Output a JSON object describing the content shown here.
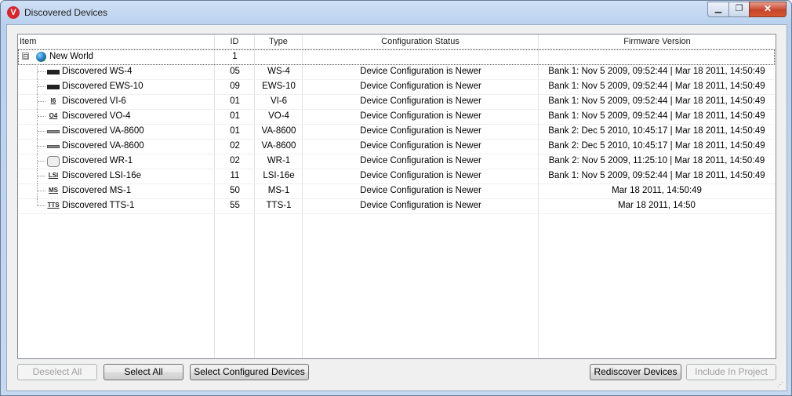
{
  "window": {
    "title": "Discovered Devices",
    "app_icon": "V"
  },
  "columns": {
    "item": "Item",
    "id": "ID",
    "type": "Type",
    "config": "Configuration Status",
    "firmware": "Firmware Version"
  },
  "root": {
    "label": "New World",
    "id": "1",
    "expander": "⊟",
    "icon": "globe-icon"
  },
  "rows": [
    {
      "icon": "bar",
      "glyph": "",
      "item": "Discovered WS-4",
      "id": "05",
      "type": "WS-4",
      "config": "Device Configuration is Newer",
      "firmware": "Bank 1: Nov  5 2009, 09:52:44 | Mar 18 2011, 14:50:49"
    },
    {
      "icon": "bar",
      "glyph": "",
      "item": "Discovered EWS-10",
      "id": "09",
      "type": "EWS-10",
      "config": "Device Configuration is Newer",
      "firmware": "Bank 1: Nov  5 2009, 09:52:44 | Mar 18 2011, 14:50:49"
    },
    {
      "icon": "text",
      "glyph": "I6",
      "item": "Discovered VI-6",
      "id": "01",
      "type": "VI-6",
      "config": "Device Configuration is Newer",
      "firmware": "Bank 1: Nov  5 2009, 09:52:44 | Mar 18 2011, 14:50:49"
    },
    {
      "icon": "text",
      "glyph": "O4",
      "item": "Discovered VO-4",
      "id": "01",
      "type": "VO-4",
      "config": "Device Configuration is Newer",
      "firmware": "Bank 1: Nov  5 2009, 09:52:44 | Mar 18 2011, 14:50:49"
    },
    {
      "icon": "slim",
      "glyph": "",
      "item": "Discovered VA-8600",
      "id": "01",
      "type": "VA-8600",
      "config": "Device Configuration is Newer",
      "firmware": "Bank 2: Dec  5 2010, 10:45:17 | Mar 18 2011, 14:50:49"
    },
    {
      "icon": "slim",
      "glyph": "",
      "item": "Discovered VA-8600",
      "id": "02",
      "type": "VA-8600",
      "config": "Device Configuration is Newer",
      "firmware": "Bank 2: Dec  5 2010, 10:45:17 | Mar 18 2011, 14:50:49"
    },
    {
      "icon": "round",
      "glyph": "",
      "item": "Discovered WR-1",
      "id": "02",
      "type": "WR-1",
      "config": "Device Configuration is Newer",
      "firmware": "Bank 2: Nov  5 2009, 11:25:10 | Mar 18 2011, 14:50:49"
    },
    {
      "icon": "text",
      "glyph": "LSI",
      "item": "Discovered LSI-16e",
      "id": "11",
      "type": "LSI-16e",
      "config": "Device Configuration is Newer",
      "firmware": "Bank 1: Nov  5 2009, 09:52:44 | Mar 18 2011, 14:50:49"
    },
    {
      "icon": "text",
      "glyph": "MS",
      "item": "Discovered MS-1",
      "id": "50",
      "type": "MS-1",
      "config": "Device Configuration is Newer",
      "firmware": "Mar 18 2011, 14:50:49"
    },
    {
      "icon": "text",
      "glyph": "TTS",
      "item": "Discovered TTS-1",
      "id": "55",
      "type": "TTS-1",
      "config": "Device Configuration is Newer",
      "firmware": "Mar 18 2011, 14:50"
    }
  ],
  "buttons": {
    "deselect_all": "Deselect All",
    "select_all": "Select All",
    "select_configured": "Select Configured Devices",
    "rediscover": "Rediscover Devices",
    "include_in_project": "Include In Project"
  }
}
